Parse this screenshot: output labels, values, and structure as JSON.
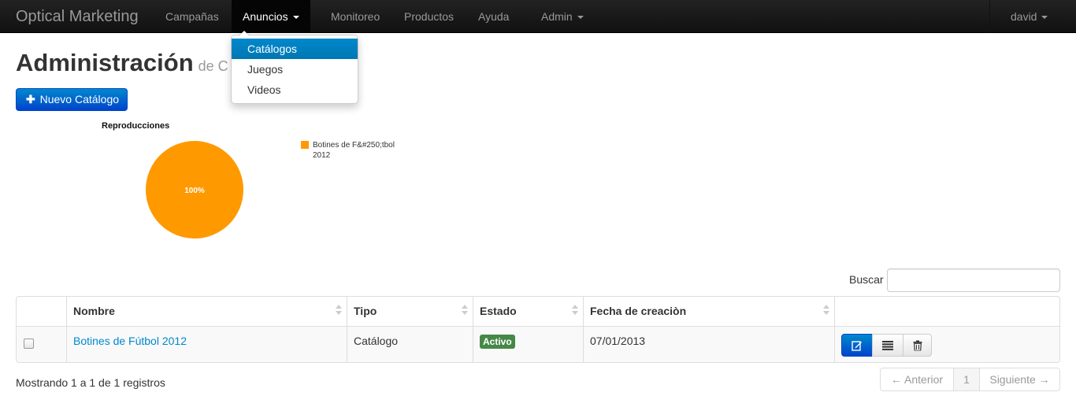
{
  "navbar": {
    "brand": "Optical Marketing",
    "items": [
      "Campañas",
      "Anuncios",
      "Monitoreo",
      "Productos",
      "Ayuda",
      "Admin"
    ],
    "user": "david"
  },
  "dropdown": {
    "items": [
      "Catálogos",
      "Juegos",
      "Videos"
    ],
    "highlighted": "Catálogos"
  },
  "page": {
    "title": "Administración",
    "subtitle": "de C"
  },
  "new_button_label": "Nuevo Catálogo",
  "chart_data": {
    "type": "pie",
    "title": "Reproducciones",
    "slices": [
      {
        "label": "Botines de F&#250;tbol 2012",
        "value": 100,
        "display": "100%",
        "color": "#ff9900"
      }
    ],
    "legend": [
      "Botines de F&#250;tbol 2012"
    ],
    "legend_position": "right"
  },
  "search": {
    "label": "Buscar",
    "value": ""
  },
  "table": {
    "columns": [
      "",
      "Nombre",
      "Tipo",
      "Estado",
      "Fecha de creaciòn",
      ""
    ],
    "rows": [
      {
        "nombre": "Botines de Fútbol 2012",
        "tipo": "Catálogo",
        "estado": "Activo",
        "fecha": "07/01/2013"
      }
    ]
  },
  "footer": {
    "info": "Mostrando 1 a 1 de 1 registros",
    "prev": "← Anterior",
    "page": "1",
    "next": "Siguiente →"
  },
  "colors": {
    "navbar": "#1b1b1b",
    "primary": "#0088cc",
    "pie": "#ff9900",
    "badge": "#468847"
  }
}
